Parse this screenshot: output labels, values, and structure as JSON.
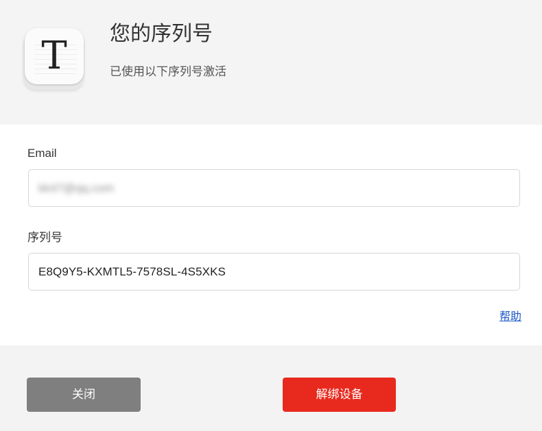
{
  "header": {
    "app_icon_letter": "T",
    "title": "您的序列号",
    "subtitle": "已使用以下序列号激活"
  },
  "form": {
    "email_label": "Email",
    "email_value": "kk47@qq.com",
    "serial_label": "序列号",
    "serial_value": "E8Q9Y5-KXMTL5-7578SL-4S5XKS",
    "help_link": "帮助"
  },
  "footer": {
    "close_label": "关闭",
    "unbind_label": "解绑设备"
  },
  "colors": {
    "accent_red": "#e8291e",
    "button_gray": "#7f7f7f",
    "link_blue": "#1a56c8"
  }
}
